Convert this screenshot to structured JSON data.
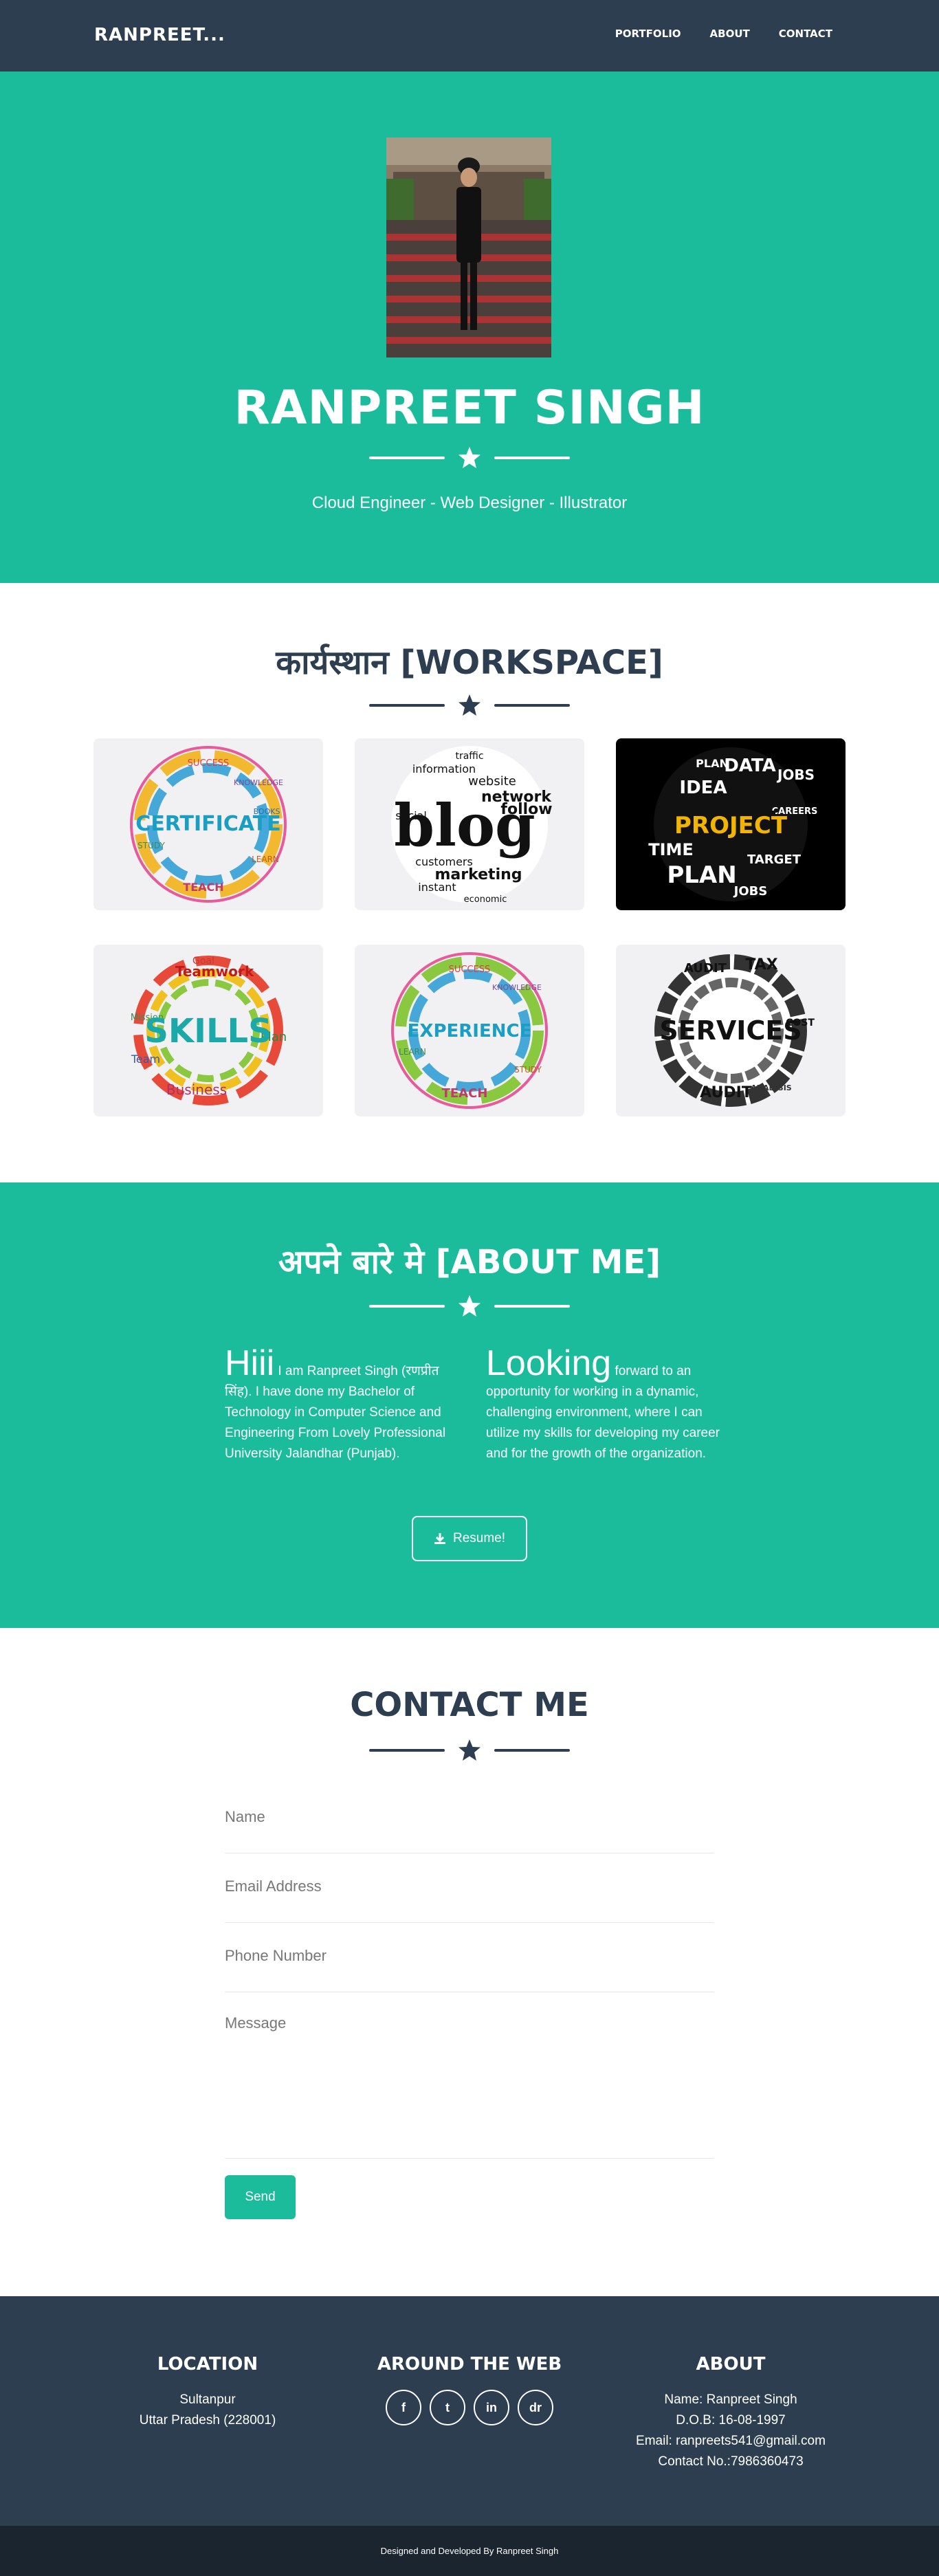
{
  "nav": {
    "brand": "RANPREET...",
    "links": [
      "PORTFOLIO",
      "ABOUT",
      "CONTACT"
    ]
  },
  "masthead": {
    "name": "RANPREET SINGH",
    "tagline": "Cloud Engineer - Web Designer - Illustrator"
  },
  "portfolio": {
    "title": "कार्यस्थान [WORKSPACE]",
    "items": [
      {
        "label": "CERTIFICATE",
        "words": [
          "SUCCESS",
          "KNOWLEDGE",
          "STUDY",
          "LEARN",
          "TEACH",
          "BOOKS"
        ]
      },
      {
        "label": "blog",
        "words": [
          "traffic",
          "information",
          "website",
          "network",
          "follow",
          "social",
          "marketing",
          "customers",
          "instant",
          "economic"
        ]
      },
      {
        "label": "PROJECT",
        "words": [
          "PLAN",
          "DATA",
          "JOBS",
          "IDEA",
          "TIME",
          "TARGET",
          "CAREERS"
        ]
      },
      {
        "label": "SKILLS",
        "words": [
          "Goal",
          "Teamwork",
          "Mission",
          "Plan",
          "Business",
          "Team"
        ]
      },
      {
        "label": "EXPERIENCE",
        "words": [
          "SUCCESS",
          "KNOWLEDGE",
          "STUDY",
          "LEARN",
          "TEACH"
        ]
      },
      {
        "label": "SERVICES",
        "words": [
          "AUDIT",
          "TAX",
          "COST",
          "AUDIT",
          "ANALYSIS"
        ]
      }
    ]
  },
  "about": {
    "title": "अपने बारे मे [ABOUT ME]",
    "left_lead": "Hiii",
    "left_text": " I am Ranpreet Singh (रणप्रीत सिंह). I have done my Bachelor of Technology in Computer Science and Engineering From Lovely Professional University Jalandhar (Punjab).",
    "right_lead": "Looking",
    "right_text": " forward to an opportunity for working in a dynamic, challenging environment, where I can utilize my skills for developing my career and for the growth of the organization.",
    "resume_label": "Resume!"
  },
  "contact": {
    "title": "CONTACT ME",
    "name_placeholder": "Name",
    "email_placeholder": "Email Address",
    "phone_placeholder": "Phone Number",
    "message_placeholder": "Message",
    "send_label": "Send"
  },
  "footer": {
    "location_title": "LOCATION",
    "location_line1": "Sultanpur",
    "location_line2": "Uttar Pradesh (228001)",
    "web_title": "AROUND THE WEB",
    "social": [
      "f",
      "t",
      "in",
      "dr"
    ],
    "about_title": "ABOUT",
    "about_name": "Name: Ranpreet Singh",
    "about_dob": "D.O.B: 16-08-1997",
    "about_email": "Email: ranpreets541@gmail.com",
    "about_phone": "Contact No.:7986360473",
    "copyright": "Designed and Developed By Ranpreet Singh"
  },
  "colors": {
    "primary": "#2c3e50",
    "accent": "#1abc9c",
    "dark": "#1a252f"
  }
}
